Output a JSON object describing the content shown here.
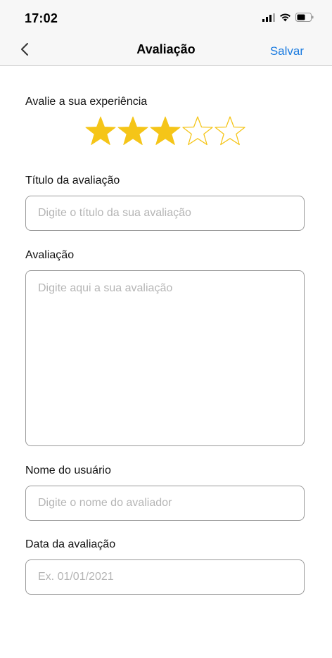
{
  "status_bar": {
    "time": "17:02",
    "icons": [
      "signal-icon",
      "wifi-icon",
      "battery-icon"
    ]
  },
  "nav": {
    "back_icon": "chevron-left-icon",
    "title": "Avaliação",
    "save_label": "Salvar"
  },
  "colors": {
    "accent": "#1a7be0",
    "star_fill": "#f5c518",
    "border": "#9a9a9a",
    "placeholder": "#b5b5b5"
  },
  "rating": {
    "label": "Avalie a sua experiência",
    "value": 3,
    "max": 5
  },
  "form": {
    "title_label": "Título da avaliação",
    "title_placeholder": "Digite o título da sua avaliação",
    "title_value": "",
    "review_label": "Avaliação",
    "review_placeholder": "Digite aqui a sua avaliação",
    "review_value": "",
    "user_label": "Nome do usuário",
    "user_placeholder": "Digite o nome do avaliador",
    "user_value": "",
    "date_label": "Data da avaliação",
    "date_placeholder": "Ex. 01/01/2021",
    "date_value": ""
  }
}
